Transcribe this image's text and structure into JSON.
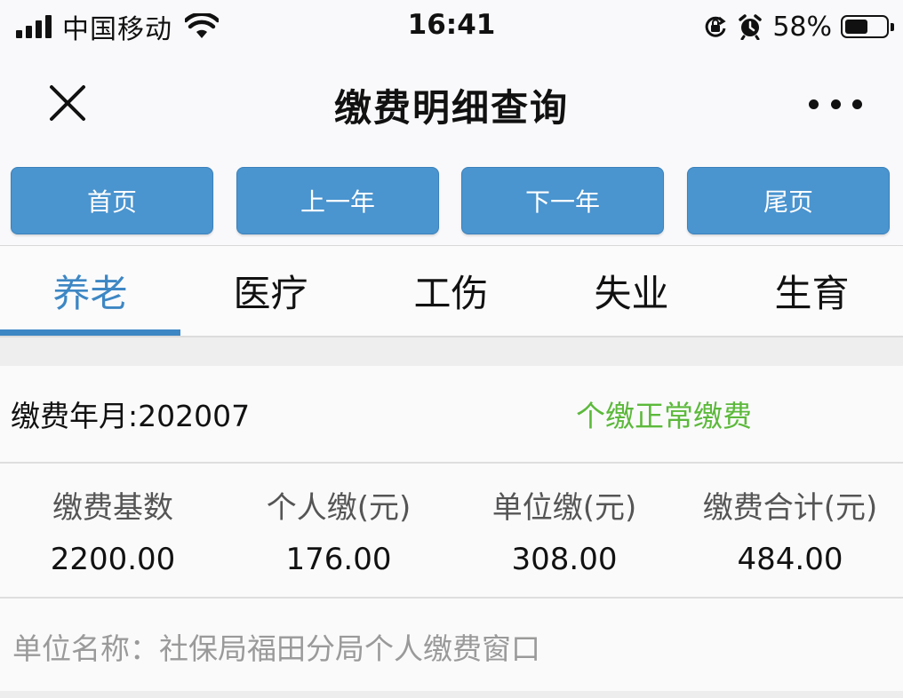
{
  "status_bar": {
    "carrier": "中国移动",
    "time": "16:41",
    "battery_percent": "58%",
    "battery_level": 0.58,
    "icons": [
      "signal-icon",
      "wifi-icon",
      "rotation-lock-icon",
      "alarm-icon",
      "battery-icon"
    ]
  },
  "nav": {
    "title": "缴费明细查询",
    "close_icon": "close-icon",
    "more_icon": "more-icon"
  },
  "pager": {
    "first": "首页",
    "prev_year": "上一年",
    "next_year": "下一年",
    "last": "尾页"
  },
  "tabs": [
    {
      "label": "养老",
      "active": true
    },
    {
      "label": "医疗",
      "active": false
    },
    {
      "label": "工伤",
      "active": false
    },
    {
      "label": "失业",
      "active": false
    },
    {
      "label": "生育",
      "active": false
    }
  ],
  "record": {
    "month_label": "缴费年月:202007",
    "status": "个缴正常缴费",
    "columns": [
      "缴费基数",
      "个人缴(元)",
      "单位缴(元)",
      "缴费合计(元)"
    ],
    "values": [
      "2200.00",
      "176.00",
      "308.00",
      "484.00"
    ],
    "unit_name": "单位名称：社保局福田分局个人缴费窗口"
  },
  "colors": {
    "accent_blue": "#3d87c4",
    "button_blue": "#4a94cf",
    "status_green": "#5cb93b",
    "muted_gray": "#9a9a9a"
  }
}
